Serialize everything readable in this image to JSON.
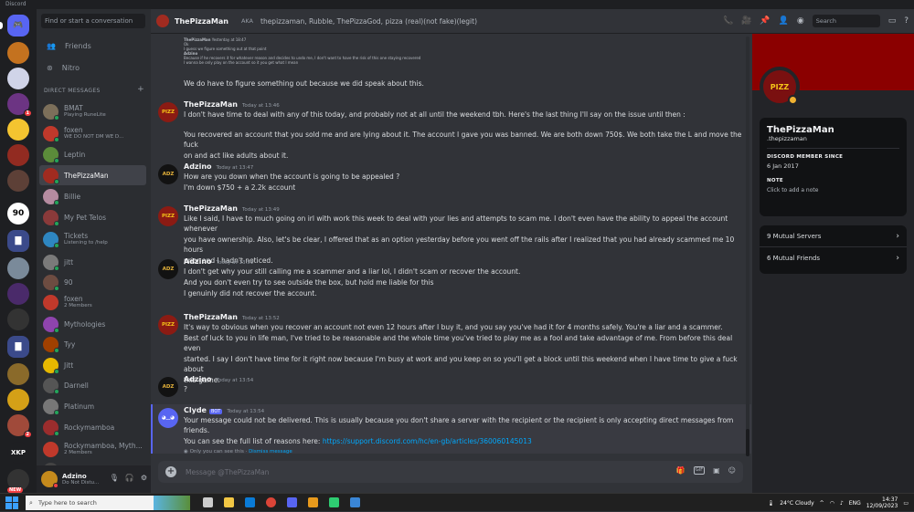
{
  "app": {
    "title": "Discord"
  },
  "guilds": [
    {
      "name": "home",
      "label": ""
    },
    {
      "name": "burger-server",
      "label": ""
    },
    {
      "name": "pokeball-server",
      "label": ""
    },
    {
      "name": "mask-server",
      "label": ""
    },
    {
      "name": "emoji-server",
      "label": ""
    },
    {
      "name": "character-server",
      "label": ""
    },
    {
      "name": "minecraft-server",
      "label": ""
    },
    {
      "name": "90-server",
      "label": "90"
    },
    {
      "name": "folder-1",
      "label": ""
    },
    {
      "name": "avatar-server-1",
      "label": ""
    },
    {
      "name": "avatar-server-2",
      "label": ""
    },
    {
      "name": "avatar-server-3",
      "label": ""
    },
    {
      "name": "folder-2",
      "label": ""
    },
    {
      "name": "avatar-server-4",
      "label": ""
    },
    {
      "name": "avatar-server-5",
      "label": ""
    },
    {
      "name": "avatar-server-6",
      "label": ""
    },
    {
      "name": "xkp-server",
      "label": "XKP"
    },
    {
      "name": "new-server",
      "label": "NEW"
    }
  ],
  "sidebar": {
    "search_placeholder": "Find or start a conversation",
    "friends": "Friends",
    "nitro": "Nitro",
    "dm_header": "DIRECT MESSAGES",
    "add": "+",
    "dms": [
      {
        "name": "BMAT",
        "sub": "Playing RuneLite",
        "color": "#7c6f5a"
      },
      {
        "name": "foxen",
        "sub": "WE DO NOT DM WE D...",
        "color": "#c0392b"
      },
      {
        "name": "Leptin",
        "sub": "",
        "color": "#5b8c3a"
      },
      {
        "name": "ThePizzaMan",
        "sub": "",
        "color": "#a12b20"
      },
      {
        "name": "Billie",
        "sub": "",
        "color": "#b58ba0"
      },
      {
        "name": "My Pet Telos",
        "sub": "",
        "color": "#8a3a3a"
      },
      {
        "name": "Tickets",
        "sub": "Listening to /help",
        "color": "#2e86c1"
      },
      {
        "name": "jitt",
        "sub": "",
        "color": "#7a7a7a"
      },
      {
        "name": "90",
        "sub": "",
        "color": "#6d4c41"
      },
      {
        "name": "foxen",
        "sub": "2 Members",
        "color": "#c0392b"
      },
      {
        "name": "Mythologies",
        "sub": "",
        "color": "#8e44ad"
      },
      {
        "name": "Tyy",
        "sub": "",
        "color": "#a04000"
      },
      {
        "name": "Jitt",
        "sub": "",
        "color": "#e6b800"
      },
      {
        "name": "Darnell",
        "sub": "",
        "color": "#555"
      },
      {
        "name": "Platinum",
        "sub": "",
        "color": "#777"
      },
      {
        "name": "Rockymamboa",
        "sub": "",
        "color": "#9b2d2d"
      },
      {
        "name": "Rockymamboa, Myth...",
        "sub": "2 Members",
        "color": "#c0392b"
      },
      {
        "name": "heffner",
        "sub": "",
        "color": "#444"
      }
    ]
  },
  "user": {
    "name": "Adzino",
    "status": "Do Not Distu..."
  },
  "header": {
    "name": "ThePizzaMan",
    "aka": "AKA",
    "aka_list": "thepizzaman, Rubble, ThePizzaGod, pizza (real)(not fake)(legit)",
    "search_placeholder": "Search"
  },
  "messages": [
    {
      "author": "ThePizzaMan",
      "time": "Today at 13:46",
      "avatar": "pizza",
      "lines": [
        "I don't have time to deal with any of this today, and probably not at all until the weekend tbh. Here's the last thing I'll say on the issue until then :",
        "",
        "You recovered an account that you sold me and are lying about it. The account I gave you was banned. We are both down 750$. We both take the L and move the fuck",
        "on and act like adults about it."
      ]
    },
    {
      "author": "Adzino",
      "time": "Today at 13:47",
      "avatar": "adz",
      "lines": [
        "How are you down when the account is going to be appealed ?",
        "I'm down $750 + a 2.2k account"
      ]
    },
    {
      "author": "ThePizzaMan",
      "time": "Today at 13:49",
      "avatar": "pizza",
      "lines": [
        "Like I said, I have to much going on irl with work this week to deal with your lies and attempts to scam me. I don't even have the ability to appeal the account whenever",
        "you have ownership. Also, let's be clear, I offered that as an option yesterday before you went off the rails after I realized that you had already scammed me 10 hours",
        "prior and I hadn't noticed."
      ]
    },
    {
      "author": "Adzino",
      "time": "Today at 13:51",
      "avatar": "adz",
      "lines": [
        "I don't get why your still calling me a scammer and a liar lol, I didn't scam or recover the account.",
        "And you don't even try to see outside the box, but hold me liable for this",
        "I genuinly did not recover the account."
      ]
    },
    {
      "author": "ThePizzaMan",
      "time": "Today at 13:52",
      "avatar": "pizza",
      "lines": [
        "It's way to obvious when you recover an account not even 12 hours after I buy it, and you say you've had it for 4 months safely. You're a liar and a scammer.",
        "Best of luck to you in life man, I've tried to be reasonable and the whole time you've tried to play me as a fool and take advantage of me. From before this deal even",
        "started. I say I don't have time for it right now because I'm busy at work and you keep on so you'll get a block until this weekend when I have time to give a fuck about",
        "this game."
      ]
    },
    {
      "author": "Adzino",
      "time": "Today at 13:54",
      "avatar": "adz",
      "lines": [
        "?"
      ]
    }
  ],
  "top_message": {
    "line": "We do have to figure something out because we did speak about this."
  },
  "quoted": {
    "author": "ThePizzaMan",
    "time": "Yesterday at 18:47",
    "author2": "Adzino",
    "l1": "Ok",
    "l2": "I guess we figure something out at that point",
    "l3": "Because if he recovers it for whatever reason and decides to undo me, I don't want to have the risk of this one staying recovered",
    "l4": "I wanna be only play on the account so it you get what I mean"
  },
  "clyde": {
    "author": "Clyde",
    "tag": "BOT",
    "time": "Today at 13:54",
    "line1": "Your message could not be delivered. This is usually because you don't share a server with the recipient or the recipient is only accepting direct messages from friends.",
    "line2": "You can see the full list of reasons here: ",
    "link": "https://support.discord.com/hc/en-gb/articles/360060145013",
    "eph": "Only you can see this · ",
    "dismiss": "Dismiss message"
  },
  "composer": {
    "placeholder": "Message @ThePizzaMan",
    "gift": "GIF"
  },
  "profile": {
    "name": "ThePizzaMan",
    "username": ".thepizzaman",
    "member_since_label": "DISCORD MEMBER SINCE",
    "member_since": "6 Jan 2017",
    "note_label": "NOTE",
    "note_placeholder": "Click to add a note",
    "mutual_servers": "9 Mutual Servers",
    "mutual_friends": "6 Mutual Friends",
    "banner_color": "#8b0000"
  },
  "taskbar": {
    "search_placeholder": "Type here to search",
    "weather": "24°C  Cloudy",
    "lang": "ENG",
    "time": "14:37",
    "date": "12/09/2023"
  }
}
